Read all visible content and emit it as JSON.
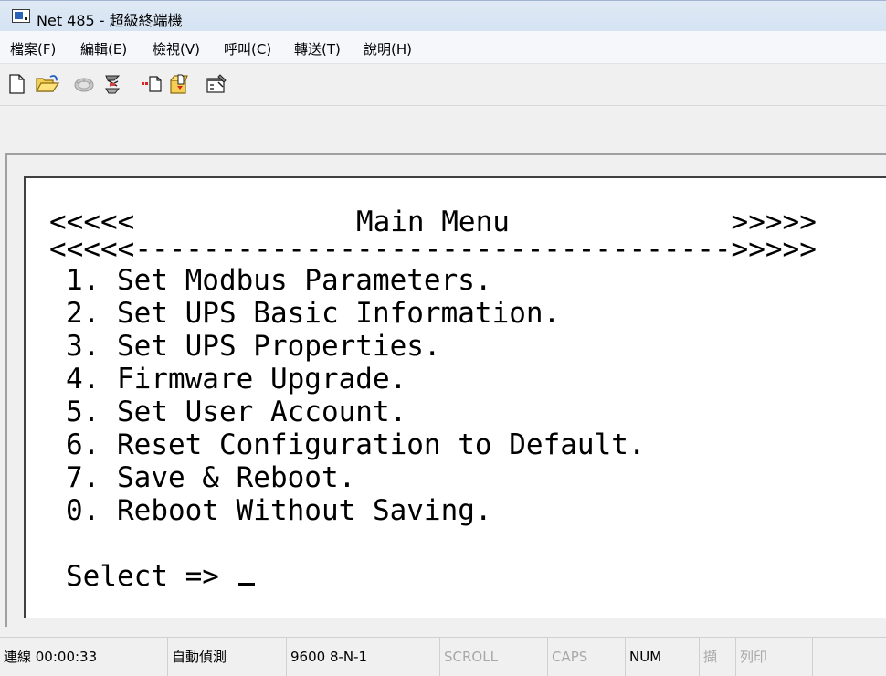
{
  "window": {
    "title": "Net 485 - 超級終端機"
  },
  "menu": [
    {
      "label": "檔案(F)"
    },
    {
      "label": "編輯(E)"
    },
    {
      "label": "檢視(V)"
    },
    {
      "label": "呼叫(C)"
    },
    {
      "label": "轉送(T)"
    },
    {
      "label": "說明(H)"
    }
  ],
  "toolbar": {
    "icons": [
      "new-document-icon",
      "open-folder-icon",
      "dial-phone-icon",
      "disconnect-phone-icon",
      "send-file-icon",
      "receive-file-icon",
      "properties-icon"
    ]
  },
  "terminal": {
    "lines": [
      "<<<<<             Main Menu             >>>>>",
      "<<<<<----------------------------------->>>>>",
      "1. Set Modbus Parameters.",
      "2. Set UPS Basic Information.",
      "3. Set UPS Properties.",
      "4. Firmware Upgrade.",
      "5. Set User Account.",
      "6. Reset Configuration to Default.",
      "7. Save & Reboot.",
      "0. Reboot Without Saving.",
      "",
      "Select =>"
    ]
  },
  "statusbar": {
    "connection": "連線 00:00:33",
    "detect": "自動偵測",
    "port": "9600 8-N-1",
    "scroll": "SCROLL",
    "caps": "CAPS",
    "num": "NUM",
    "capture": "擷",
    "print": "列印"
  },
  "colors": {
    "title_bar": "#d5e3f3",
    "terminal_bg": "#ffffff",
    "status_dim": "#a8a8a8"
  }
}
